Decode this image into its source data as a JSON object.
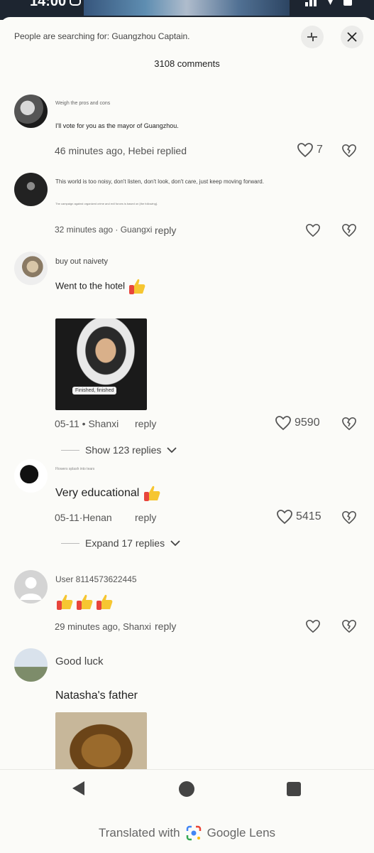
{
  "status_bar": {
    "time": "14:00"
  },
  "header": {
    "search_hint": "People are searching for: Guangzhou Captain.",
    "comments_count": "3108 comments"
  },
  "comments": [
    {
      "username": "Weigh the pros and cons",
      "text": "I'll vote for you as the mayor of Guangzhou.",
      "meta": "46 minutes ago, Hebei replied",
      "likes": "7"
    },
    {
      "username": "This world is too noisy, don't listen, don't look, don't care, just keep moving forward.",
      "text": "The campaign against organized crime and evil forces is based on [the following].",
      "meta": "32 minutes ago · Guangxi",
      "reply_label": "reply"
    },
    {
      "username": "buy out naivety",
      "text": "Went to the hotel",
      "image_caption": "Finished, finished",
      "meta": "05-11 • Shanxi",
      "reply_label": "reply",
      "likes": "9590",
      "show_replies": "Show 123 replies"
    },
    {
      "username": "Flowers splash into tears",
      "text": "Very educational",
      "meta": "05-11·Henan",
      "reply_label": "reply",
      "likes": "5415",
      "show_replies": "Expand 17 replies"
    },
    {
      "username": "User 8114573622445",
      "meta": "29 minutes ago, Shanxi",
      "reply_label": "reply"
    },
    {
      "username": "Good luck",
      "text": "Natasha's father"
    }
  ],
  "footer": {
    "translated_with": "Translated with",
    "brand": "Google Lens"
  },
  "colors": {
    "background": "#fbfbf8",
    "thumb_yellow": "#f6c631",
    "thumb_red": "#e8453c"
  }
}
